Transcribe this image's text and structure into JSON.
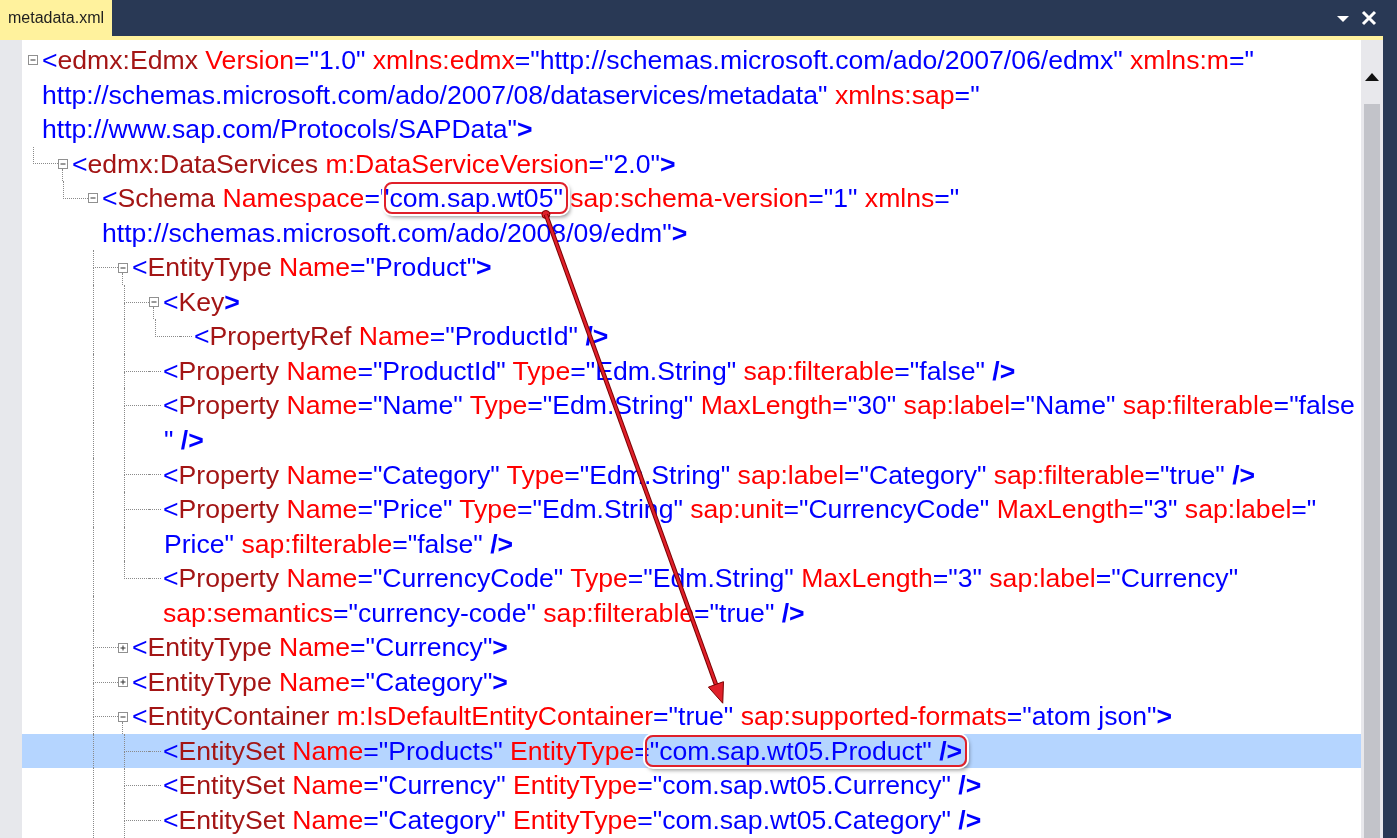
{
  "tab": {
    "title": "metadata.xml",
    "selected": true
  },
  "document": {
    "expanded": true,
    "selected": false,
    "lines": [
      [
        {
          "kind": "punct",
          "text": "<"
        },
        {
          "kind": "tag",
          "text": "edmx:Edmx"
        },
        {
          "kind": "attr",
          "text": " Version"
        },
        {
          "kind": "value",
          "text": "=\"1.0\""
        },
        {
          "kind": "attr",
          "text": " xmlns:edmx"
        },
        {
          "kind": "value",
          "text": "=\"http://schemas.microsoft.com/ado/2007/06/edmx\""
        },
        {
          "kind": "attr",
          "text": " xmlns:m"
        },
        {
          "kind": "value",
          "text": "=\""
        }
      ],
      [
        {
          "kind": "value",
          "text": "http://schemas.microsoft.com/ado/2007/08/dataservices/metadata\""
        },
        {
          "kind": "attr",
          "text": " xmlns:sap"
        },
        {
          "kind": "value",
          "text": "=\""
        }
      ],
      [
        {
          "kind": "value",
          "text": "http://www.sap.com/Protocols/SAPData\""
        },
        {
          "kind": "end",
          "text": ">"
        }
      ]
    ],
    "children": [
      {
        "expanded": true,
        "selected": false,
        "lines": [
          [
            {
              "kind": "punct",
              "text": "<"
            },
            {
              "kind": "tag",
              "text": "edmx:DataServices"
            },
            {
              "kind": "attr",
              "text": " m:DataServiceVersion"
            },
            {
              "kind": "value",
              "text": "=\"2.0\""
            },
            {
              "kind": "end",
              "text": ">"
            }
          ]
        ],
        "children": [
          {
            "expanded": true,
            "selected": false,
            "more_below": true,
            "lines": [
              [
                {
                  "kind": "punct",
                  "text": "<"
                },
                {
                  "kind": "tag",
                  "text": "Schema"
                },
                {
                  "kind": "attr",
                  "text": " Namespace"
                },
                {
                  "kind": "value",
                  "text": "=\""
                },
                {
                  "kind": "callout",
                  "tokens": [
                    {
                      "kind": "value",
                      "text": "com.sap.wt05\""
                    }
                  ]
                },
                {
                  "kind": "attr",
                  "text": " sap:schema-version"
                },
                {
                  "kind": "value",
                  "text": "=\"1\""
                },
                {
                  "kind": "attr",
                  "text": " xmlns"
                },
                {
                  "kind": "value",
                  "text": "=\""
                }
              ],
              [
                {
                  "kind": "value",
                  "text": "http://schemas.microsoft.com/ado/2008/09/edm\""
                },
                {
                  "kind": "end",
                  "text": ">"
                }
              ]
            ],
            "children": [
              {
                "expanded": true,
                "selected": false,
                "lines": [
                  [
                    {
                      "kind": "punct",
                      "text": "<"
                    },
                    {
                      "kind": "tag",
                      "text": "EntityType"
                    },
                    {
                      "kind": "attr",
                      "text": " Name"
                    },
                    {
                      "kind": "value",
                      "text": "=\"Product\""
                    },
                    {
                      "kind": "end",
                      "text": ">"
                    }
                  ]
                ],
                "children": [
                  {
                    "expanded": true,
                    "selected": false,
                    "lines": [
                      [
                        {
                          "kind": "punct",
                          "text": "<"
                        },
                        {
                          "kind": "tag",
                          "text": "Key"
                        },
                        {
                          "kind": "end",
                          "text": ">"
                        }
                      ]
                    ],
                    "children": [
                      {
                        "selected": false,
                        "lines": [
                          [
                            {
                              "kind": "punct",
                              "text": "<"
                            },
                            {
                              "kind": "tag",
                              "text": "PropertyRef"
                            },
                            {
                              "kind": "attr",
                              "text": " Name"
                            },
                            {
                              "kind": "value",
                              "text": "=\"ProductId\""
                            },
                            {
                              "kind": "end",
                              "text": " />"
                            }
                          ]
                        ]
                      }
                    ]
                  },
                  {
                    "selected": false,
                    "lines": [
                      [
                        {
                          "kind": "punct",
                          "text": "<"
                        },
                        {
                          "kind": "tag",
                          "text": "Property"
                        },
                        {
                          "kind": "attr",
                          "text": " Name"
                        },
                        {
                          "kind": "value",
                          "text": "=\"ProductId\""
                        },
                        {
                          "kind": "attr",
                          "text": " Type"
                        },
                        {
                          "kind": "value",
                          "text": "=\"Edm.String\""
                        },
                        {
                          "kind": "attr",
                          "text": " sap:filterable"
                        },
                        {
                          "kind": "value",
                          "text": "=\"false\""
                        },
                        {
                          "kind": "end",
                          "text": " />"
                        }
                      ]
                    ]
                  },
                  {
                    "selected": false,
                    "lines": [
                      [
                        {
                          "kind": "punct",
                          "text": "<"
                        },
                        {
                          "kind": "tag",
                          "text": "Property"
                        },
                        {
                          "kind": "attr",
                          "text": " Name"
                        },
                        {
                          "kind": "value",
                          "text": "=\"Name\""
                        },
                        {
                          "kind": "attr",
                          "text": " Type"
                        },
                        {
                          "kind": "value",
                          "text": "=\"Edm.String\""
                        },
                        {
                          "kind": "attr",
                          "text": " MaxLength"
                        },
                        {
                          "kind": "value",
                          "text": "=\"30\""
                        },
                        {
                          "kind": "attr",
                          "text": " sap:label"
                        },
                        {
                          "kind": "value",
                          "text": "=\"Name\""
                        },
                        {
                          "kind": "attr",
                          "text": " sap:filterable"
                        },
                        {
                          "kind": "value",
                          "text": "=\"false"
                        }
                      ],
                      [
                        {
                          "kind": "value",
                          "text": "\""
                        },
                        {
                          "kind": "end",
                          "text": " />"
                        }
                      ]
                    ]
                  },
                  {
                    "selected": false,
                    "lines": [
                      [
                        {
                          "kind": "punct",
                          "text": "<"
                        },
                        {
                          "kind": "tag",
                          "text": "Property"
                        },
                        {
                          "kind": "attr",
                          "text": " Name"
                        },
                        {
                          "kind": "value",
                          "text": "=\"Category\""
                        },
                        {
                          "kind": "attr",
                          "text": " Type"
                        },
                        {
                          "kind": "value",
                          "text": "=\"Edm.String\""
                        },
                        {
                          "kind": "attr",
                          "text": " sap:label"
                        },
                        {
                          "kind": "value",
                          "text": "=\"Category\""
                        },
                        {
                          "kind": "attr",
                          "text": " sap:filterable"
                        },
                        {
                          "kind": "value",
                          "text": "=\"true\""
                        },
                        {
                          "kind": "end",
                          "text": " />"
                        }
                      ]
                    ]
                  },
                  {
                    "selected": false,
                    "lines": [
                      [
                        {
                          "kind": "punct",
                          "text": "<"
                        },
                        {
                          "kind": "tag",
                          "text": "Property"
                        },
                        {
                          "kind": "attr",
                          "text": " Name"
                        },
                        {
                          "kind": "value",
                          "text": "=\"Price\""
                        },
                        {
                          "kind": "attr",
                          "text": " Type"
                        },
                        {
                          "kind": "value",
                          "text": "=\"Edm.String\""
                        },
                        {
                          "kind": "attr",
                          "text": " sap:unit"
                        },
                        {
                          "kind": "value",
                          "text": "=\"CurrencyCode\""
                        },
                        {
                          "kind": "attr",
                          "text": " MaxLength"
                        },
                        {
                          "kind": "value",
                          "text": "=\"3\""
                        },
                        {
                          "kind": "attr",
                          "text": " sap:label"
                        },
                        {
                          "kind": "value",
                          "text": "=\""
                        }
                      ],
                      [
                        {
                          "kind": "value",
                          "text": "Price\""
                        },
                        {
                          "kind": "attr",
                          "text": " sap:filterable"
                        },
                        {
                          "kind": "value",
                          "text": "=\"false\""
                        },
                        {
                          "kind": "end",
                          "text": " />"
                        }
                      ]
                    ]
                  },
                  {
                    "selected": false,
                    "lines": [
                      [
                        {
                          "kind": "punct",
                          "text": "<"
                        },
                        {
                          "kind": "tag",
                          "text": "Property"
                        },
                        {
                          "kind": "attr",
                          "text": " Name"
                        },
                        {
                          "kind": "value",
                          "text": "=\"CurrencyCode\""
                        },
                        {
                          "kind": "attr",
                          "text": " Type"
                        },
                        {
                          "kind": "value",
                          "text": "=\"Edm.String\""
                        },
                        {
                          "kind": "attr",
                          "text": " MaxLength"
                        },
                        {
                          "kind": "value",
                          "text": "=\"3\""
                        },
                        {
                          "kind": "attr",
                          "text": " sap:label"
                        },
                        {
                          "kind": "value",
                          "text": "=\"Currency\""
                        }
                      ],
                      [
                        {
                          "kind": "attr",
                          "text": "sap:semantics"
                        },
                        {
                          "kind": "value",
                          "text": "=\"currency-code\""
                        },
                        {
                          "kind": "attr",
                          "text": " sap:filterable"
                        },
                        {
                          "kind": "value",
                          "text": "=\"true\""
                        },
                        {
                          "kind": "end",
                          "text": " />"
                        }
                      ]
                    ]
                  }
                ]
              },
              {
                "expanded": false,
                "selected": false,
                "lines": [
                  [
                    {
                      "kind": "punct",
                      "text": "<"
                    },
                    {
                      "kind": "tag",
                      "text": "EntityType"
                    },
                    {
                      "kind": "attr",
                      "text": " Name"
                    },
                    {
                      "kind": "value",
                      "text": "=\"Currency\""
                    },
                    {
                      "kind": "end",
                      "text": ">"
                    }
                  ]
                ]
              },
              {
                "expanded": false,
                "selected": false,
                "lines": [
                  [
                    {
                      "kind": "punct",
                      "text": "<"
                    },
                    {
                      "kind": "tag",
                      "text": "EntityType"
                    },
                    {
                      "kind": "attr",
                      "text": " Name"
                    },
                    {
                      "kind": "value",
                      "text": "=\"Category\""
                    },
                    {
                      "kind": "end",
                      "text": ">"
                    }
                  ]
                ]
              },
              {
                "expanded": true,
                "selected": false,
                "more_below": true,
                "lines": [
                  [
                    {
                      "kind": "punct",
                      "text": "<"
                    },
                    {
                      "kind": "tag",
                      "text": "EntityContainer"
                    },
                    {
                      "kind": "attr",
                      "text": " m:IsDefaultEntityContainer"
                    },
                    {
                      "kind": "value",
                      "text": "=\"true\""
                    },
                    {
                      "kind": "attr",
                      "text": " sap:supported-formats"
                    },
                    {
                      "kind": "value",
                      "text": "=\"atom json\""
                    },
                    {
                      "kind": "end",
                      "text": ">"
                    }
                  ]
                ],
                "children": [
                  {
                    "selected": true,
                    "lines": [
                      [
                        {
                          "kind": "punct",
                          "text": "<"
                        },
                        {
                          "kind": "tag",
                          "text": "EntitySet"
                        },
                        {
                          "kind": "attr",
                          "text": " Name"
                        },
                        {
                          "kind": "value",
                          "text": "=\"Products\""
                        },
                        {
                          "kind": "attr",
                          "text": " EntityType"
                        },
                        {
                          "kind": "value",
                          "text": "="
                        },
                        {
                          "kind": "callout",
                          "tokens": [
                            {
                              "kind": "value",
                              "text": "\"com.sap.wt05.Product\""
                            },
                            {
                              "kind": "end",
                              "text": " />"
                            }
                          ]
                        }
                      ]
                    ]
                  },
                  {
                    "selected": false,
                    "lines": [
                      [
                        {
                          "kind": "punct",
                          "text": "<"
                        },
                        {
                          "kind": "tag",
                          "text": "EntitySet"
                        },
                        {
                          "kind": "attr",
                          "text": " Name"
                        },
                        {
                          "kind": "value",
                          "text": "=\"Currency\""
                        },
                        {
                          "kind": "attr",
                          "text": " EntityType"
                        },
                        {
                          "kind": "value",
                          "text": "=\"com.sap.wt05.Currency\""
                        },
                        {
                          "kind": "end",
                          "text": " />"
                        }
                      ]
                    ]
                  },
                  {
                    "selected": false,
                    "lines": [
                      [
                        {
                          "kind": "punct",
                          "text": "<"
                        },
                        {
                          "kind": "tag",
                          "text": "EntitySet"
                        },
                        {
                          "kind": "attr",
                          "text": " Name"
                        },
                        {
                          "kind": "value",
                          "text": "=\"Category\""
                        },
                        {
                          "kind": "attr",
                          "text": " EntityType"
                        },
                        {
                          "kind": "value",
                          "text": "=\"com.sap.wt05.Category\""
                        },
                        {
                          "kind": "end",
                          "text": " />"
                        }
                      ]
                    ]
                  }
                ]
              }
            ]
          }
        ]
      }
    ]
  }
}
